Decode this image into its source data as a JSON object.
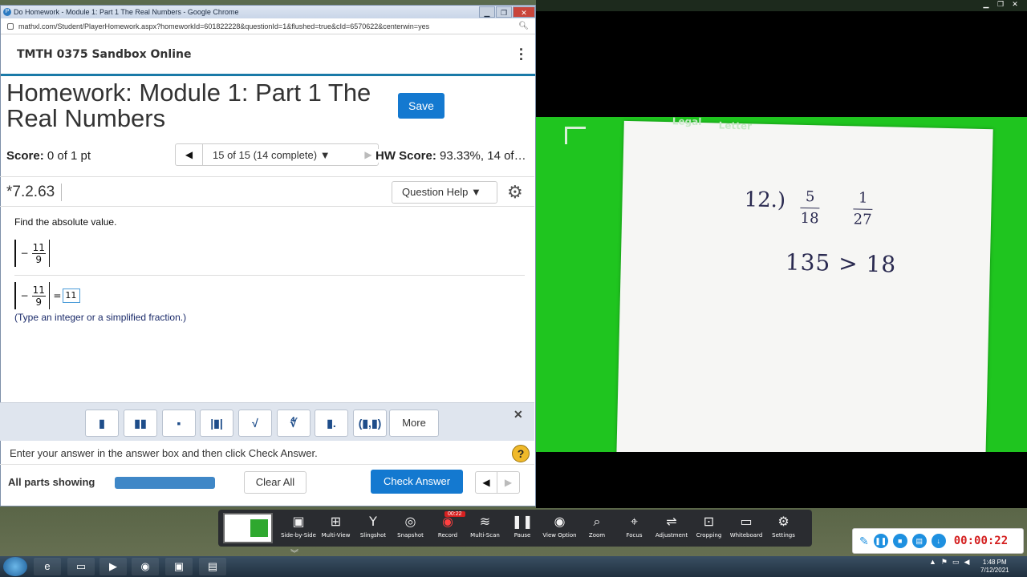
{
  "browser": {
    "title": "Do Homework - Module 1: Part 1 The Real Numbers - Google Chrome",
    "url": "mathxl.com/Student/PlayerHomework.aspx?homeworkId=601822228&questionId=1&flushed=true&cId=6570622&centerwin=yes"
  },
  "app": {
    "course": "TMTH 0375 Sandbox Online",
    "homework_title": "Homework: Module 1: Part 1 The Real Numbers",
    "save_label": "Save"
  },
  "scorebar": {
    "score_label": "Score:",
    "score_value": "0 of 1 pt",
    "question_select": "15 of 15 (14 complete)",
    "hw_score_label": "HW Score:",
    "hw_score_value": "93.33%, 14 of…"
  },
  "question": {
    "id": "*7.2.63",
    "help_label": "Question Help",
    "prompt": "Find the absolute value.",
    "sign": "−",
    "numerator": "11",
    "denominator": "9",
    "equals": "=",
    "answer_value": "11",
    "hint": "(Type an integer or a simplified fraction.)"
  },
  "palette": {
    "buttons": [
      "▮",
      "▮▮",
      "▪",
      "|▮|",
      "√",
      "∜",
      "▮.",
      "(▮,▮)"
    ],
    "more_label": "More"
  },
  "instructions": "Enter your answer in the answer box and then click Check Answer.",
  "footer": {
    "all_parts": "All parts showing",
    "progress": 1.0,
    "clear_all": "Clear All",
    "check_answer": "Check Answer"
  },
  "camera": {
    "paper_tab_1": "Legal",
    "paper_tab_2": "Letter",
    "handwriting_number": "12.)",
    "fraction_1": {
      "num": "5",
      "den": "18"
    },
    "fraction_2": {
      "num": "1",
      "den": "27"
    },
    "handwriting_line2": "135 > 18"
  },
  "recorder": {
    "tools": [
      {
        "label": "Side-by-Side",
        "icon": "side-by-side-icon"
      },
      {
        "label": "Multi-View",
        "icon": "multi-view-icon"
      },
      {
        "label": "Slingshot",
        "icon": "slingshot-icon"
      },
      {
        "label": "Snapshot",
        "icon": "snapshot-icon"
      },
      {
        "label": "Record",
        "icon": "record-icon"
      },
      {
        "label": "Multi-Scan",
        "icon": "multi-scan-icon"
      },
      {
        "label": "Pause",
        "icon": "pause-icon"
      },
      {
        "label": "View Option",
        "icon": "view-option-icon"
      },
      {
        "label": "Zoom",
        "icon": "zoom-icon"
      },
      {
        "label": "Focus",
        "icon": "focus-icon"
      },
      {
        "label": "Adjustment",
        "icon": "adjustment-icon"
      },
      {
        "label": "Cropping",
        "icon": "cropping-icon"
      },
      {
        "label": "Whiteboard",
        "icon": "whiteboard-icon"
      },
      {
        "label": "Settings",
        "icon": "settings-icon"
      }
    ],
    "record_badge": "00:22",
    "timer": "00:00:22"
  },
  "taskbar": {
    "time": "1:48 PM",
    "date": "7/12/2021"
  },
  "colors": {
    "primary_button": "#1479d0",
    "header_rule": "#1a7aa8",
    "camera_green": "#1fc51f",
    "timer_red": "#d42020"
  }
}
